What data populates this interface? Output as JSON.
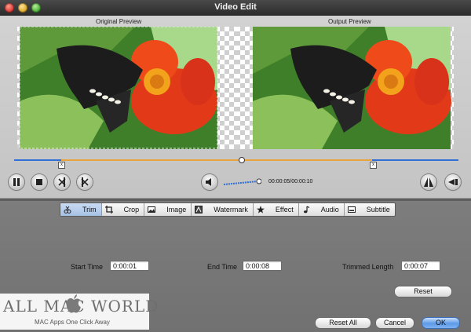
{
  "window": {
    "title": "Video Edit"
  },
  "preview": {
    "original_label": "Original Preview",
    "output_label": "Output Preview"
  },
  "playback": {
    "timecode": "00:00:05/00:00:10"
  },
  "tabs": [
    {
      "label": "Trim",
      "icon": "scissors-icon",
      "active": true
    },
    {
      "label": "Crop",
      "icon": "crop-icon",
      "active": false
    },
    {
      "label": "Image",
      "icon": "image-icon",
      "active": false
    },
    {
      "label": "Watermark",
      "icon": "watermark-icon",
      "active": false
    },
    {
      "label": "Effect",
      "icon": "star-icon",
      "active": false
    },
    {
      "label": "Audio",
      "icon": "music-note-icon",
      "active": false
    },
    {
      "label": "Subtitle",
      "icon": "subtitle-icon",
      "active": false
    }
  ],
  "trim": {
    "start_label": "Start Time",
    "start_value": "0:00:01",
    "end_label": "End Time",
    "end_value": "0:00:08",
    "length_label": "Trimmed Length",
    "length_value": "0:00:07",
    "reset_label": "Reset"
  },
  "footer": {
    "reset_all_label": "Reset All",
    "cancel_label": "Cancel",
    "ok_label": "OK"
  },
  "watermark": {
    "brand": "ALL MAC WORLD",
    "tagline": "MAC Apps One Click Away"
  },
  "colors": {
    "timeline_blue": "#2f6fd6",
    "timeline_orange": "#e8a53d",
    "ok_button": "#5c9ae8"
  }
}
